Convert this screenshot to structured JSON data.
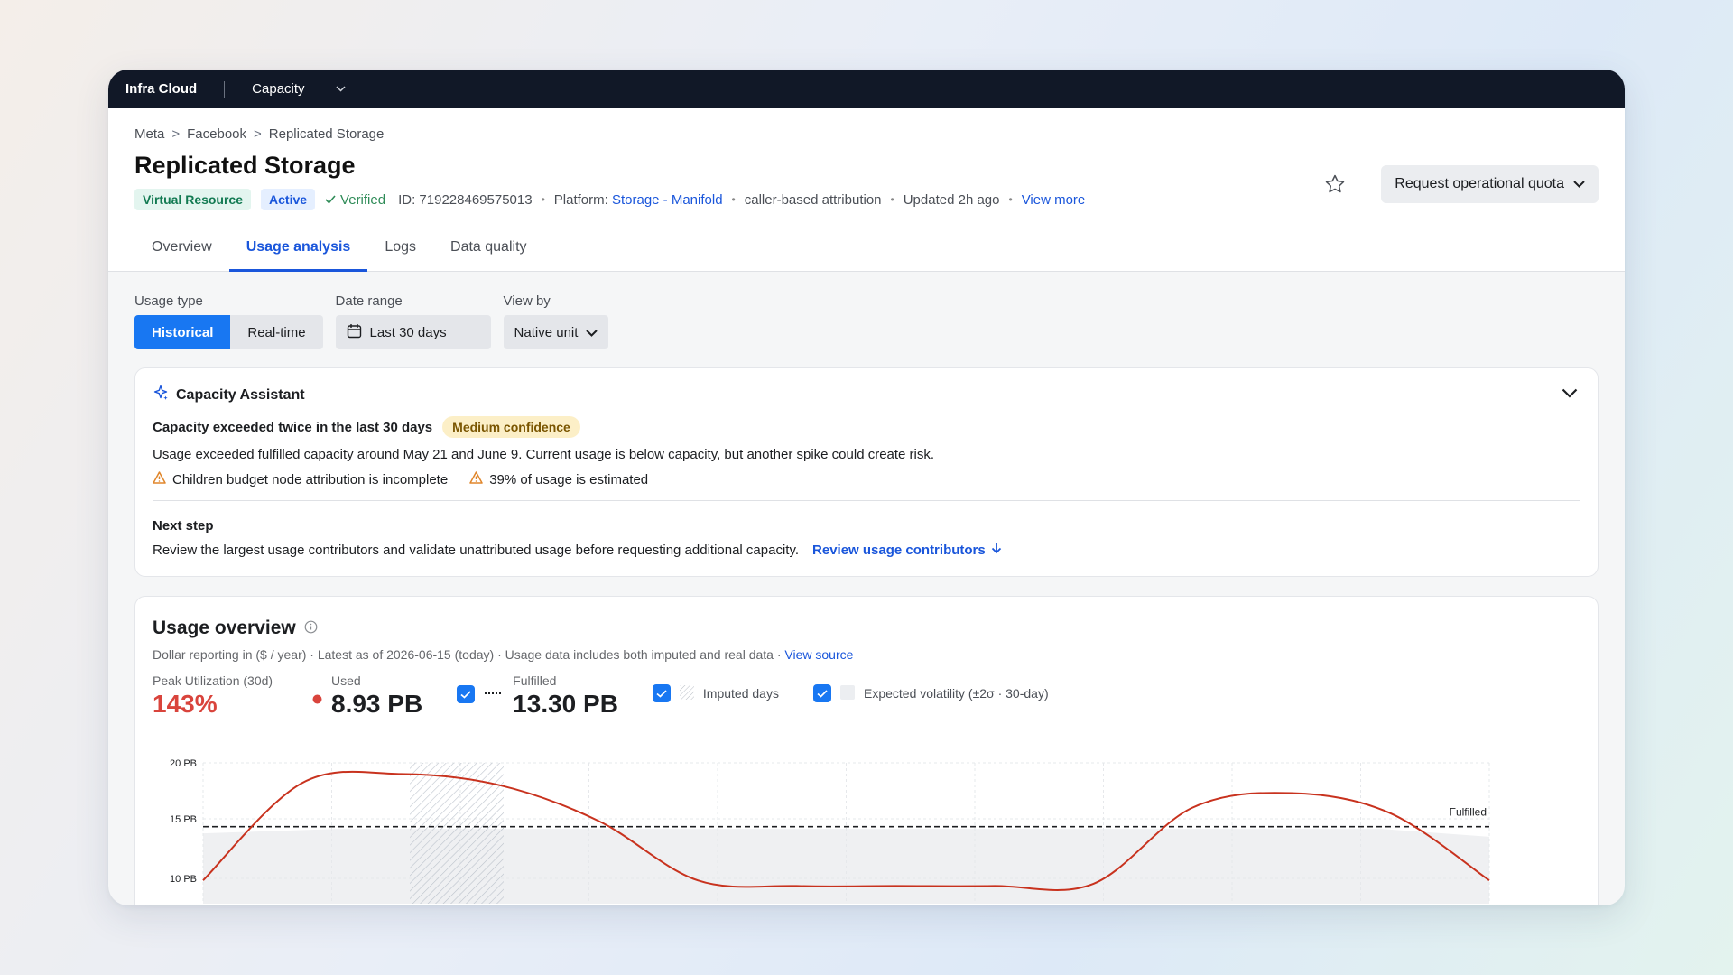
{
  "topbar": {
    "brand": "Infra Cloud",
    "product": "Capacity"
  },
  "breadcrumb": [
    "Meta",
    "Facebook",
    "Replicated Storage"
  ],
  "page_title": "Replicated Storage",
  "meta": {
    "tag_virtual": "Virtual Resource",
    "tag_active": "Active",
    "verified": "Verified",
    "id": "ID: 719228469575013",
    "platform_label": "Platform: ",
    "platform_value": "Storage - Manifold",
    "attribution": "caller-based attribution",
    "updated": "Updated 2h ago",
    "view_more": "View more"
  },
  "actions": {
    "request_quota": "Request operational quota"
  },
  "tabs": [
    "Overview",
    "Usage analysis",
    "Logs",
    "Data quality"
  ],
  "controls": {
    "usage_type_label": "Usage type",
    "usage_type_options": [
      "Historical",
      "Real-time"
    ],
    "date_range_label": "Date range",
    "date_range_value": "Last 30 days",
    "view_by_label": "View by",
    "view_by_value": "Native unit"
  },
  "assistant": {
    "title": "Capacity Assistant",
    "headline": "Capacity exceeded twice in the last 30 days",
    "confidence": "Medium confidence",
    "description": "Usage exceeded fulfilled capacity around May 21 and June 9. Current usage is below capacity, but another spike could create risk.",
    "warnings": [
      "Children budget node attribution is incomplete",
      "39% of usage is estimated"
    ],
    "next_step_title": "Next step",
    "next_step_text": "Review the largest usage contributors and validate unattributed usage before requesting additional capacity.",
    "next_step_link": "Review usage contributors"
  },
  "overview": {
    "title": "Usage overview",
    "subtitle": "Dollar reporting in ($ / year) · Latest as of 2026-06-15 (today) · Usage data includes both imputed and real data · ",
    "view_source": "View source",
    "peak_label": "Peak Utilization (30d)",
    "peak_value": "143%",
    "used_label": "Used",
    "used_value": "8.93 PB",
    "fulfilled_label": "Fulfilled",
    "fulfilled_value": "13.30 PB",
    "imputed_label": "Imputed days",
    "volatility_label": "Expected volatility (±2σ · 30-day)"
  },
  "colors": {
    "accent": "#1877f2",
    "danger": "#d9443c",
    "used_line": "#c8321e"
  },
  "chart_data": {
    "type": "line",
    "y_tick_labels": [
      "20 PB",
      "15 PB",
      "10 PB"
    ],
    "ylim": [
      10,
      20
    ],
    "fulfilled_label": "Fulfilled",
    "fulfilled_value": 14.3,
    "series": [
      {
        "name": "Used",
        "values": [
          9.5,
          18.2,
          19.0,
          18.0,
          14.8,
          9.5,
          9.0,
          9.0,
          9.0,
          9.2,
          16.0,
          17.3,
          15.5,
          9.5
        ]
      }
    ]
  }
}
